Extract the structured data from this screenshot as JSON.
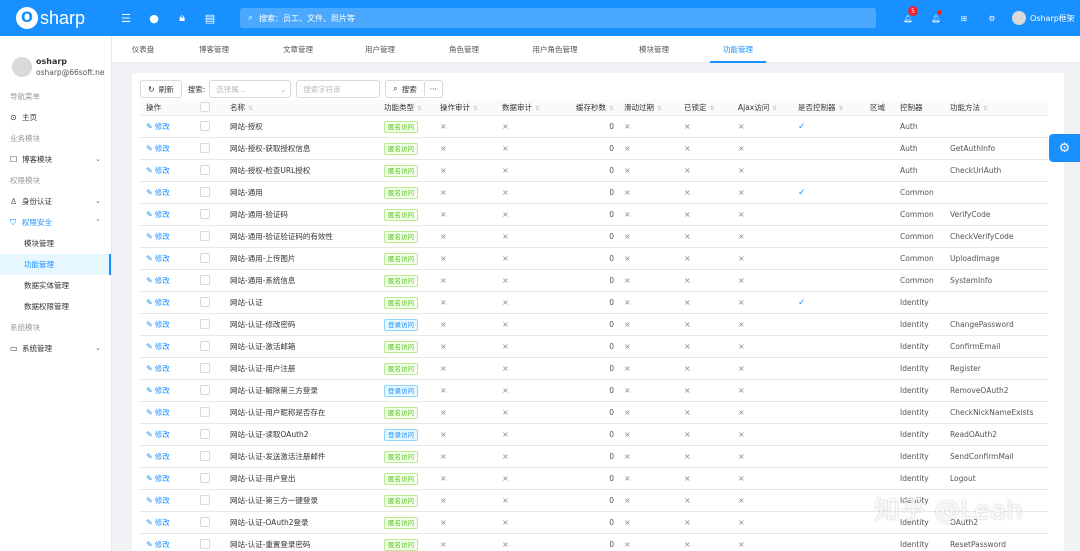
{
  "header": {
    "logo_letter": "O",
    "logo_text": "sharp",
    "search_placeholder": "搜索：员工、文件、照片等",
    "notification_count": "5",
    "user_name": "Osharp框架"
  },
  "sidebar": {
    "profile_name": "osharp",
    "profile_email": "osharp@66soft.ne",
    "nav": [
      {
        "kind": "group",
        "label": "导航菜单"
      },
      {
        "kind": "item",
        "label": "主页",
        "icon": "home-icon"
      },
      {
        "kind": "group",
        "label": "业务模块"
      },
      {
        "kind": "item",
        "label": "博客模块",
        "icon": "blog-icon",
        "chevron": "down"
      },
      {
        "kind": "group",
        "label": "权限模块"
      },
      {
        "kind": "item",
        "label": "身份认证",
        "icon": "user-icon",
        "chevron": "down"
      },
      {
        "kind": "item",
        "label": "权限安全",
        "icon": "shield-icon",
        "chevron": "up",
        "open": true
      },
      {
        "kind": "sub",
        "label": "模块管理"
      },
      {
        "kind": "sub",
        "label": "功能管理",
        "active": true
      },
      {
        "kind": "sub",
        "label": "数据实体管理"
      },
      {
        "kind": "sub",
        "label": "数据权限管理"
      },
      {
        "kind": "group",
        "label": "系统模块"
      },
      {
        "kind": "item",
        "label": "系统管理",
        "icon": "desktop-icon",
        "chevron": "down"
      }
    ]
  },
  "tabs": [
    "仪表盘",
    "博客管理",
    "文章管理",
    "用户管理",
    "角色管理",
    "用户角色管理",
    "模块管理",
    "功能管理"
  ],
  "active_tab": 7,
  "toolbar": {
    "refresh_label": "刷新",
    "search_label": "搜索:",
    "select_placeholder": "选择属...",
    "input_placeholder": "搜索字符串",
    "search_button": "搜索",
    "more": "···"
  },
  "table": {
    "headers": [
      "操作",
      "",
      "名称",
      "功能类型",
      "操作审计",
      "数据审计",
      "缓存秒数",
      "滑动过期",
      "已锁定",
      "Ajax访问",
      "是否控制器",
      "区域",
      "控制器",
      "功能方法"
    ],
    "edit_label": "修改",
    "rows": [
      {
        "name": "网站-授权",
        "type": "匿名访问",
        "tc": "green",
        "cache": "0",
        "ctrl": "Auth",
        "action": "",
        "is_ctrl": true
      },
      {
        "name": "网站-授权-获取授权信息",
        "type": "匿名访问",
        "tc": "green",
        "cache": "0",
        "ctrl": "Auth",
        "action": "GetAuthInfo",
        "is_ctrl": false
      },
      {
        "name": "网站-授权-检查URL授权",
        "type": "匿名访问",
        "tc": "green",
        "cache": "0",
        "ctrl": "Auth",
        "action": "CheckUrlAuth",
        "is_ctrl": false
      },
      {
        "name": "网站-通用",
        "type": "匿名访问",
        "tc": "green",
        "cache": "0",
        "ctrl": "Common",
        "action": "",
        "is_ctrl": true
      },
      {
        "name": "网站-通用-验证码",
        "type": "匿名访问",
        "tc": "green",
        "cache": "0",
        "ctrl": "Common",
        "action": "VerifyCode",
        "is_ctrl": false
      },
      {
        "name": "网站-通用-验证验证码的有效性",
        "type": "匿名访问",
        "tc": "green",
        "cache": "0",
        "ctrl": "Common",
        "action": "CheckVerifyCode",
        "is_ctrl": false
      },
      {
        "name": "网站-通用-上传图片",
        "type": "匿名访问",
        "tc": "green",
        "cache": "0",
        "ctrl": "Common",
        "action": "UploadImage",
        "is_ctrl": false
      },
      {
        "name": "网站-通用-系统信息",
        "type": "匿名访问",
        "tc": "green",
        "cache": "0",
        "ctrl": "Common",
        "action": "SystemInfo",
        "is_ctrl": false
      },
      {
        "name": "网站-认证",
        "type": "匿名访问",
        "tc": "green",
        "cache": "0",
        "ctrl": "Identity",
        "action": "",
        "is_ctrl": true
      },
      {
        "name": "网站-认证-修改密码",
        "type": "登录访问",
        "tc": "blue",
        "cache": "0",
        "ctrl": "Identity",
        "action": "ChangePassword",
        "is_ctrl": false
      },
      {
        "name": "网站-认证-激活邮箱",
        "type": "匿名访问",
        "tc": "green",
        "cache": "0",
        "ctrl": "Identity",
        "action": "ConfirmEmail",
        "is_ctrl": false
      },
      {
        "name": "网站-认证-用户注册",
        "type": "匿名访问",
        "tc": "green",
        "cache": "0",
        "ctrl": "Identity",
        "action": "Register",
        "is_ctrl": false
      },
      {
        "name": "网站-认证-解除第三方登录",
        "type": "登录访问",
        "tc": "blue",
        "cache": "0",
        "ctrl": "Identity",
        "action": "RemoveOAuth2",
        "is_ctrl": false
      },
      {
        "name": "网站-认证-用户昵称是否存在",
        "type": "匿名访问",
        "tc": "green",
        "cache": "0",
        "ctrl": "Identity",
        "action": "CheckNickNameExists",
        "is_ctrl": false
      },
      {
        "name": "网站-认证-读取OAuth2",
        "type": "登录访问",
        "tc": "blue",
        "cache": "0",
        "ctrl": "Identity",
        "action": "ReadOAuth2",
        "is_ctrl": false
      },
      {
        "name": "网站-认证-发送激活注册邮件",
        "type": "匿名访问",
        "tc": "green",
        "cache": "0",
        "ctrl": "Identity",
        "action": "SendConfirmMail",
        "is_ctrl": false
      },
      {
        "name": "网站-认证-用户登出",
        "type": "匿名访问",
        "tc": "green",
        "cache": "0",
        "ctrl": "Identity",
        "action": "Logout",
        "is_ctrl": false
      },
      {
        "name": "网站-认证-第三方一键登录",
        "type": "匿名访问",
        "tc": "green",
        "cache": "0",
        "ctrl": "Identity",
        "action": "",
        "is_ctrl": false
      },
      {
        "name": "网站-认证-OAuth2登录",
        "type": "匿名访问",
        "tc": "green",
        "cache": "0",
        "ctrl": "Identity",
        "action": "OAuth2",
        "is_ctrl": false
      },
      {
        "name": "网站-认证-重置登录密码",
        "type": "匿名访问",
        "tc": "green",
        "cache": "0",
        "ctrl": "Identity",
        "action": "ResetPassword",
        "is_ctrl": false
      }
    ]
  },
  "watermark": "知乎 @Leah",
  "colors": {
    "primary": "#1890ff",
    "tag_green": "#52c41a",
    "tag_blue": "#1890ff"
  }
}
